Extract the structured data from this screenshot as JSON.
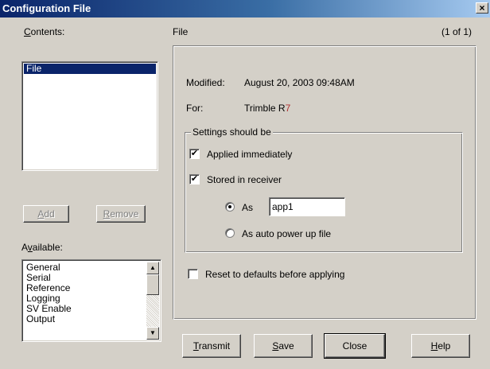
{
  "window": {
    "title": "Configuration File",
    "close_glyph": "×"
  },
  "contents": {
    "label_accel": "C",
    "label_rest": "ontents:",
    "items": [
      "File"
    ],
    "selected_index": 0
  },
  "file_header": {
    "title": "File",
    "page_indicator": "(1 of 1)"
  },
  "buttons": {
    "add_accel": "A",
    "add_rest": "dd",
    "remove_accel": "R",
    "remove_rest": "emove",
    "transmit_accel": "T",
    "transmit_rest": "ransmit",
    "save_accel": "S",
    "save_rest": "ave",
    "close": "Close",
    "help_accel": "H",
    "help_rest": "elp"
  },
  "available": {
    "label_pre": "A",
    "label_accel": "v",
    "label_rest": "ailable:",
    "items": [
      "General",
      "Serial",
      "Reference",
      "Logging",
      "SV Enable",
      "Output"
    ]
  },
  "details": {
    "modified_label": "Modified:",
    "modified_value": "August 20, 2003 09:48AM",
    "for_label": "For:",
    "for_value_main": "Trimble R",
    "for_value_suffix": "7"
  },
  "settings": {
    "group_label": "Settings should be",
    "applied_immediately": {
      "label": "Applied immediately",
      "checked": true
    },
    "stored_in_receiver": {
      "label": "Stored in receiver",
      "checked": true
    },
    "as_option": {
      "label": "As",
      "selected": true,
      "value": "app1"
    },
    "auto_power_option": {
      "label": "As auto power up file",
      "selected": false
    },
    "check_glyph": "✔"
  },
  "reset": {
    "label": "Reset to defaults before applying",
    "checked": false
  },
  "scrollbar": {
    "up_glyph": "▲",
    "down_glyph": "▼"
  }
}
